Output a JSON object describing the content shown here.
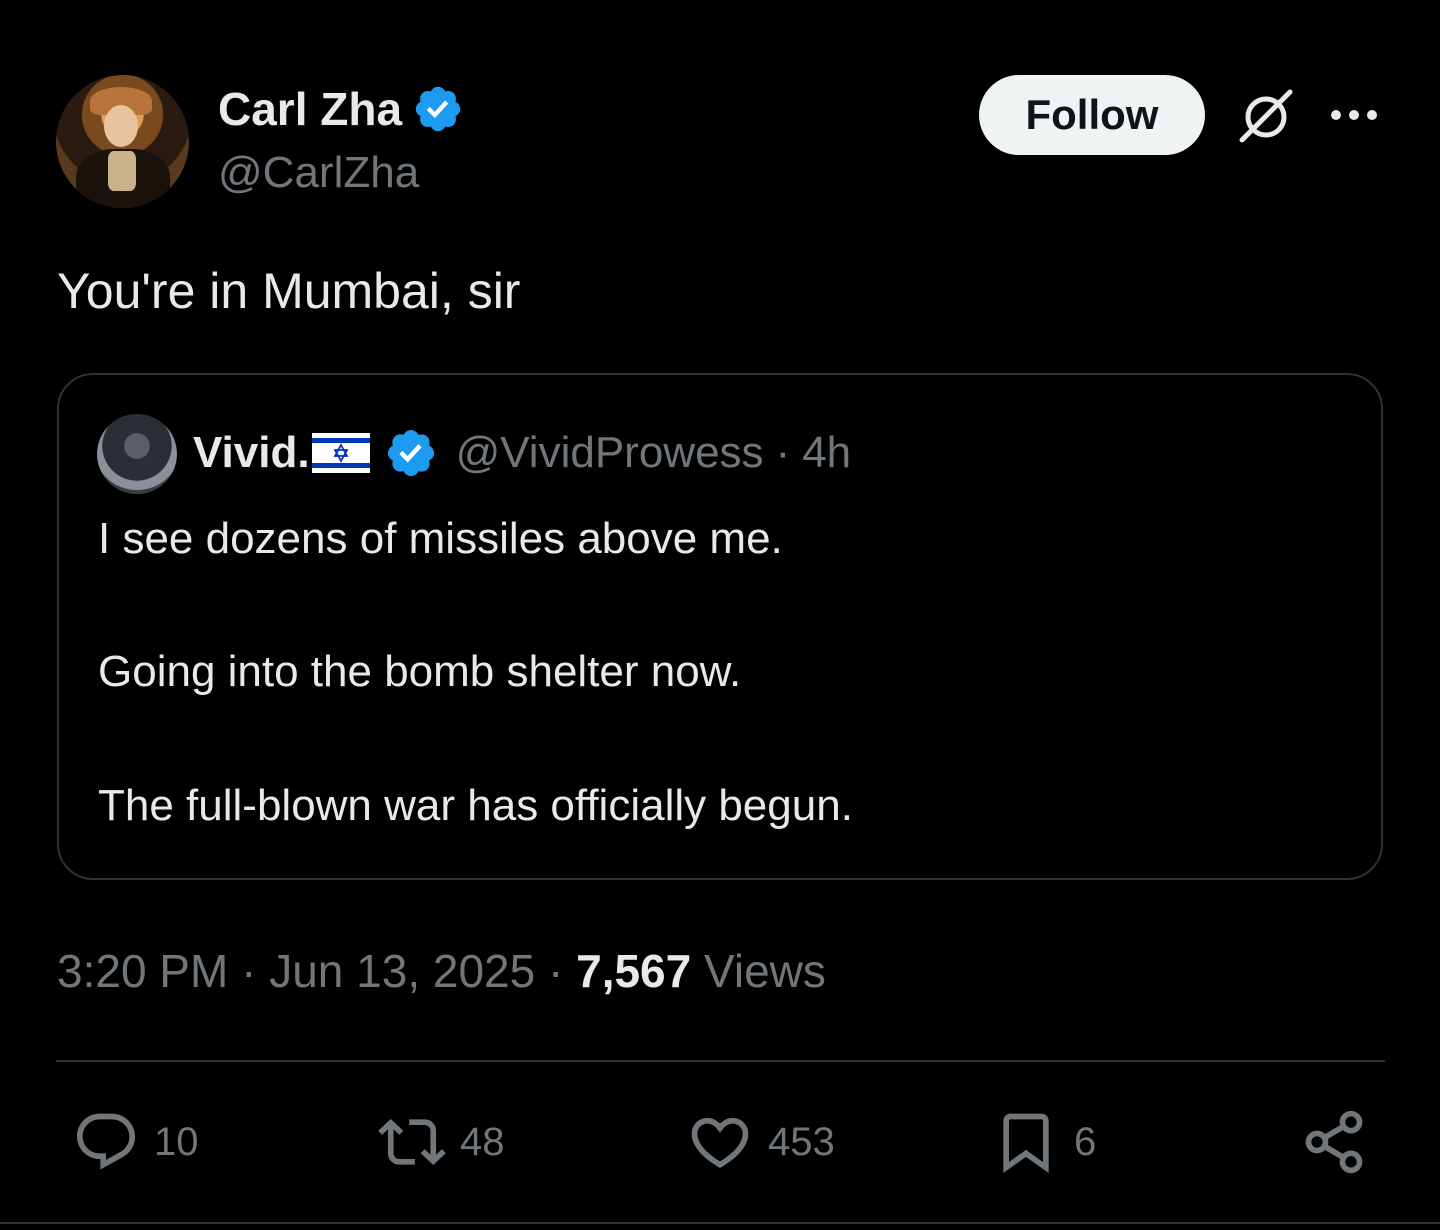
{
  "author": {
    "name": "Carl Zha",
    "handle": "@CarlZha",
    "verified": true
  },
  "header": {
    "follow_label": "Follow",
    "grok_icon": "grok-icon",
    "more_icon": "more-icon"
  },
  "tweet": {
    "text": "You're in Mumbai, sir"
  },
  "quote": {
    "name": "Vivid.",
    "flag": "israel-flag",
    "handle": "@VividProwess",
    "separator": "·",
    "time": "4h",
    "lines": [
      "I see dozens of missiles above me.",
      "Going into the bomb shelter now.",
      "The full-blown war has officially begun."
    ]
  },
  "meta": {
    "time": "3:20 PM",
    "date": "Jun 13, 2025",
    "views_count": "7,567",
    "views_label": "Views"
  },
  "actions": {
    "replies": "10",
    "reposts": "48",
    "likes": "453",
    "bookmarks": "6"
  },
  "colors": {
    "background": "#000000",
    "text": "#e7e9ea",
    "muted": "#71767b",
    "verified": "#1d9bf0",
    "border": "#2f3336"
  }
}
